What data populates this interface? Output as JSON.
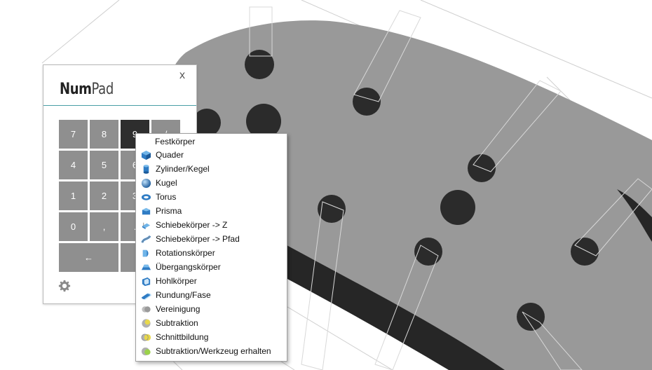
{
  "numpad": {
    "title_bold": "Num",
    "title_light": "Pad",
    "close_label": "x",
    "keys": [
      "7",
      "8",
      "9",
      "/",
      "4",
      "5",
      "6",
      "*",
      "1",
      "2",
      "3",
      "-",
      "0",
      ",",
      ".",
      "+",
      "←",
      "="
    ],
    "settings_icon": "gear-icon"
  },
  "menu": {
    "header": "Festkörper",
    "items": [
      {
        "label": "Quader",
        "icon": "cube-icon"
      },
      {
        "label": "Zylinder/Kegel",
        "icon": "cylinder-icon"
      },
      {
        "label": "Kugel",
        "icon": "sphere-icon"
      },
      {
        "label": "Torus",
        "icon": "torus-icon"
      },
      {
        "label": "Prisma",
        "icon": "prism-icon"
      },
      {
        "label": "Schiebekörper -> Z",
        "icon": "extrude-z-icon"
      },
      {
        "label": "Schiebekörper -> Pfad",
        "icon": "extrude-path-icon"
      },
      {
        "label": "Rotationskörper",
        "icon": "revolve-icon"
      },
      {
        "label": "Übergangskörper",
        "icon": "loft-icon"
      },
      {
        "label": "Hohlkörper",
        "icon": "shell-icon"
      },
      {
        "label": "Rundung/Fase",
        "icon": "fillet-icon"
      },
      {
        "label": "Vereinigung",
        "icon": "union-icon"
      },
      {
        "label": "Subtraktion",
        "icon": "subtract-icon"
      },
      {
        "label": "Schnittbildung",
        "icon": "intersect-icon"
      },
      {
        "label": "Subtraktion/Werkzeug erhalten",
        "icon": "subtract-keep-icon"
      }
    ]
  },
  "colors": {
    "part": "#999999",
    "hole": "#2b2b2b",
    "accent": "#4a9ea6"
  }
}
